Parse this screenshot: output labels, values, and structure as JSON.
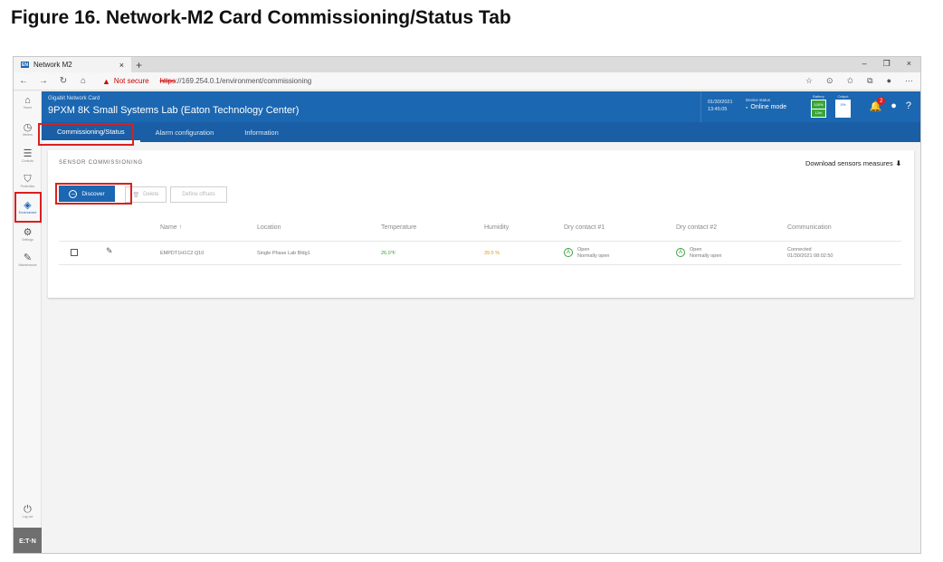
{
  "figure": {
    "title": "Figure 16. Network-M2 Card Commissioning/Status Tab"
  },
  "browser": {
    "tab_title": "Network M2",
    "tab_favicon": "EN",
    "new_tab": "+",
    "tab_close": "×",
    "warning_text": "Not secure",
    "url_scheme": "https",
    "url_rest": "://169.254.0.1/environment/commissioning",
    "window_controls": [
      "–",
      "❐",
      "×"
    ],
    "nav_icons": [
      "←",
      "→",
      "↻",
      "⌂"
    ],
    "toolbar_icons": [
      "☆",
      "⊙",
      "✩",
      "⧉",
      "●",
      "⋯"
    ]
  },
  "sidebar": {
    "items": [
      {
        "label": "Home",
        "icon": "⌂"
      },
      {
        "label": "Meters",
        "icon": "◷"
      },
      {
        "label": "Controls",
        "icon": "☰"
      },
      {
        "label": "Protection",
        "icon": "⛉"
      },
      {
        "label": "Environment",
        "icon": "◈"
      },
      {
        "label": "Settings",
        "icon": "⚙"
      },
      {
        "label": "Maintenance",
        "icon": "✎"
      }
    ],
    "bottom": {
      "label": "Log out",
      "icon": "⏻"
    },
    "logo": "E:T·N"
  },
  "header": {
    "card_type": "Gigabit Network Card",
    "card_name": "9PXM 8K Small Systems Lab (Eaton Technology Center)",
    "date": "01/30/2021",
    "time": "13:45:05",
    "device_status_label": "Device status",
    "device_status_value": "Online mode",
    "battery_label": "Battery",
    "battery_top": "100%",
    "battery_bottom": "12m",
    "output_label": "Output",
    "output_top": "0%",
    "output_bottom": "",
    "notifications_count": "2"
  },
  "subnav": {
    "tabs": [
      "Commissioning/Status",
      "Alarm configuration",
      "Information"
    ]
  },
  "panel": {
    "section_title": "SENSOR COMMISSIONING",
    "download_label": "Download sensors measures",
    "buttons": {
      "discover": "Discover",
      "delete": "Delete",
      "define_offsets": "Define offsets"
    },
    "columns": [
      "Name ↑",
      "Location",
      "Temperature",
      "Humidity",
      "Dry contact #1",
      "Dry contact #2",
      "Communication"
    ],
    "row": {
      "name": "EMPDT1H1C2 Q10",
      "location": "Single Phase Lab Bldg1",
      "temperature": "26.0°F",
      "humidity": "39.5 %",
      "dc1_state": "Open",
      "dc1_mode": "Normally open",
      "dc2_state": "Open",
      "dc2_mode": "Normally open",
      "comm_status": "Connected",
      "comm_time": "01/30/2021 08:02:50"
    }
  }
}
